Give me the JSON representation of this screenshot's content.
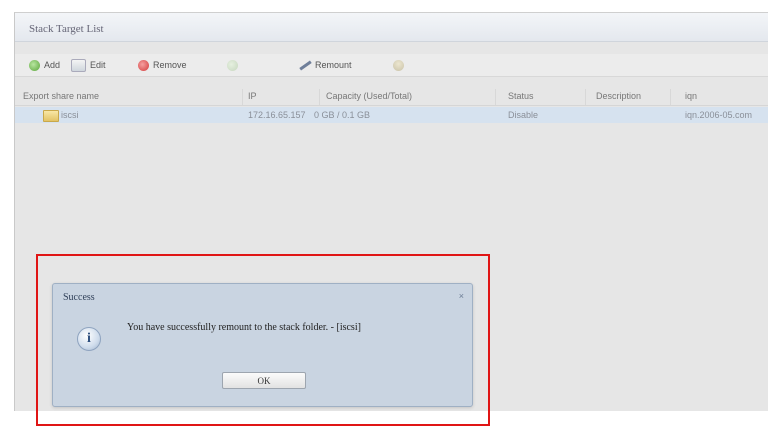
{
  "panel": {
    "title": "Stack Target List"
  },
  "toolbar": {
    "add_label": "Add",
    "edit_label": "Edit",
    "remove_label": "Remove",
    "disabled_label": "",
    "remount_label": "Remount"
  },
  "grid": {
    "columns": [
      "Export share name",
      "IP",
      "Capacity (Used/Total)",
      "Status",
      "Description",
      "iqn"
    ],
    "rows": [
      {
        "name": "iscsi",
        "ip": "172.16.65.157",
        "capacity": "0 GB / 0.1 GB",
        "status": "Disable",
        "description": "",
        "iqn": "iqn.2006-05.com"
      }
    ]
  },
  "dialog": {
    "title": "Success",
    "close_glyph": "×",
    "message": "You have successfully remount to the stack folder. - [iscsi]",
    "ok_label": "OK"
  },
  "colors": {
    "highlight": "#e01515",
    "dialog_bg": "#c9d4e1",
    "selected_row": "#d6e2ef"
  }
}
